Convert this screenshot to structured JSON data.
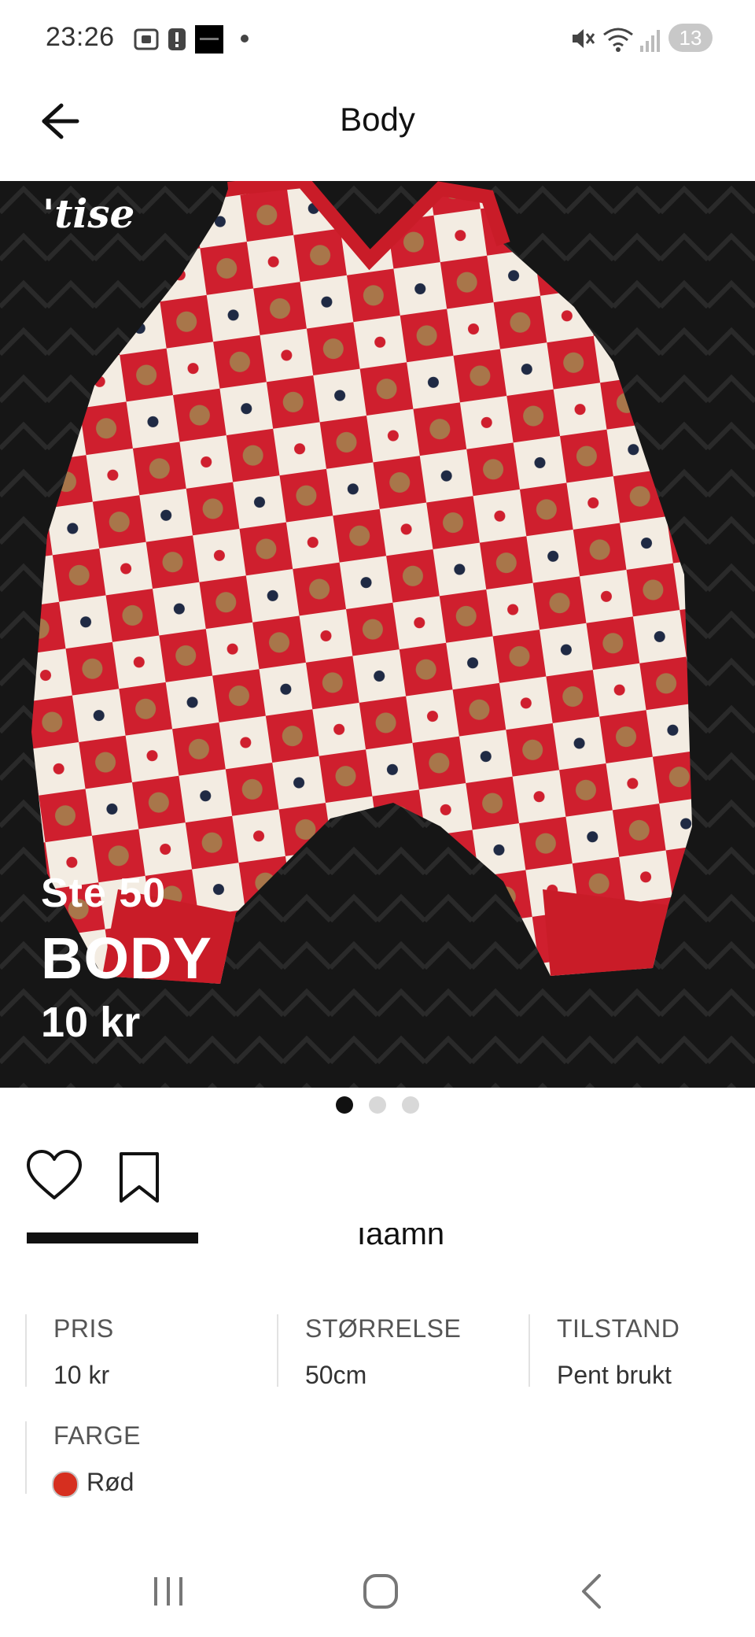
{
  "status_bar": {
    "time": "23:26",
    "notifications_count": "13",
    "icons": [
      "screenshot-icon",
      "alert-icon",
      "app-thumbnail-icon",
      "dot-icon",
      "mute-icon",
      "wifi-icon",
      "signal-icon"
    ]
  },
  "header": {
    "title": "Body",
    "back_icon": "arrow-left-icon"
  },
  "listing_photo": {
    "brand_watermark": "'tise",
    "overlay_size": "Ste 50",
    "overlay_name": "BODY",
    "overlay_price": "10 kr",
    "page_count": 3,
    "active_page": 1
  },
  "actions": {
    "like_icon": "heart-icon",
    "save_icon": "bookmark-icon",
    "seller_partial": "Iaamh"
  },
  "details": {
    "price_label": "PRIS",
    "price_value": "10 kr",
    "size_label": "STØRRELSE",
    "size_value": "50cm",
    "condition_label": "TILSTAND",
    "condition_value": "Pent brukt",
    "color_label": "FARGE",
    "color_value": "Rød",
    "color_hex": "#d62f1f"
  },
  "system_nav": {
    "icons": [
      "recent-apps-icon",
      "home-icon",
      "back-chevron-icon"
    ]
  }
}
